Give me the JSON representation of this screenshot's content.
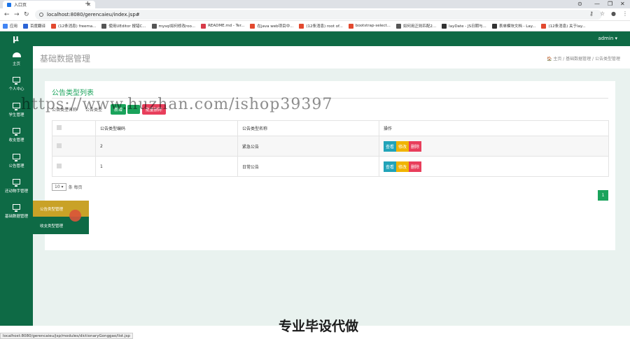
{
  "browser": {
    "tab_title": "入口页",
    "new_tab": "+",
    "window_controls": [
      "⊙",
      "—",
      "❐",
      "✕"
    ],
    "url": "localhost:8080/gerencaieu/index.jsp#",
    "bookmarks": [
      {
        "label": "应用",
        "color": "#4285f4"
      },
      {
        "label": "百度翻译",
        "color": "#2b64d6"
      },
      {
        "label": "(12条消息) freema...",
        "color": "#e2492f"
      },
      {
        "label": "使用UEditor 报错C...",
        "color": "#555555"
      },
      {
        "label": "mysql如何修改roo...",
        "color": "#555555"
      },
      {
        "label": "README.md - Ter...",
        "color": "#d73a49"
      },
      {
        "label": "在java web项目中...",
        "color": "#e2492f"
      },
      {
        "label": "(12条消息) root of...",
        "color": "#e2492f"
      },
      {
        "label": "bootstrap-select...",
        "color": "#e2492f"
      },
      {
        "label": "如何用正则匹配2...",
        "color": "#555555"
      },
      {
        "label": "layDate - JS日期与...",
        "color": "#333333"
      },
      {
        "label": "表单模块文档 - Lay...",
        "color": "#333333"
      },
      {
        "label": "(12条消息) 关于lay...",
        "color": "#e2492f"
      }
    ]
  },
  "header": {
    "logo": "μ",
    "user": "admin ▾"
  },
  "sidebar": {
    "items": [
      {
        "label": "主页",
        "icon": "dashboard-icon"
      },
      {
        "label": "个人中心",
        "icon": "monitor-icon"
      },
      {
        "label": "学生管理",
        "icon": "monitor-icon"
      },
      {
        "label": "收支管理",
        "icon": "monitor-icon"
      },
      {
        "label": "公告管理",
        "icon": "monitor-icon"
      },
      {
        "label": "还动物手管理",
        "icon": "monitor-icon"
      },
      {
        "label": "基础数据管理",
        "icon": "monitor-icon"
      }
    ],
    "flyout": [
      "公告类型管理",
      "收支类型管理"
    ]
  },
  "page": {
    "title": "基础数据管理",
    "breadcrumb": "🏠 主页 / 基础数据管理 / 公告类型管理"
  },
  "card": {
    "title": "公告类型列表",
    "filter_label_1": "公告类型名称",
    "filter_label_2": "公告类型",
    "add_label": "新增",
    "delete_label": "批量删除",
    "columns": [
      "",
      "公告类型编码",
      "公告类型名称",
      "操作"
    ],
    "rows": [
      {
        "code": "2",
        "name": "紧急公告"
      },
      {
        "code": "1",
        "name": "日常公告"
      }
    ],
    "actions": {
      "view": "查看",
      "edit": "修改",
      "delete": "删除"
    },
    "page_size": "10",
    "per_page": "条 每页",
    "current_page": "1"
  },
  "watermarks": {
    "url": "https://www.huzhan.com/ishop39397",
    "footer": "专业毕设代做"
  },
  "status_bar": "localhost:8080/gerencaieu/jsp/modules/dictionaryGonggao/list.jsp"
}
